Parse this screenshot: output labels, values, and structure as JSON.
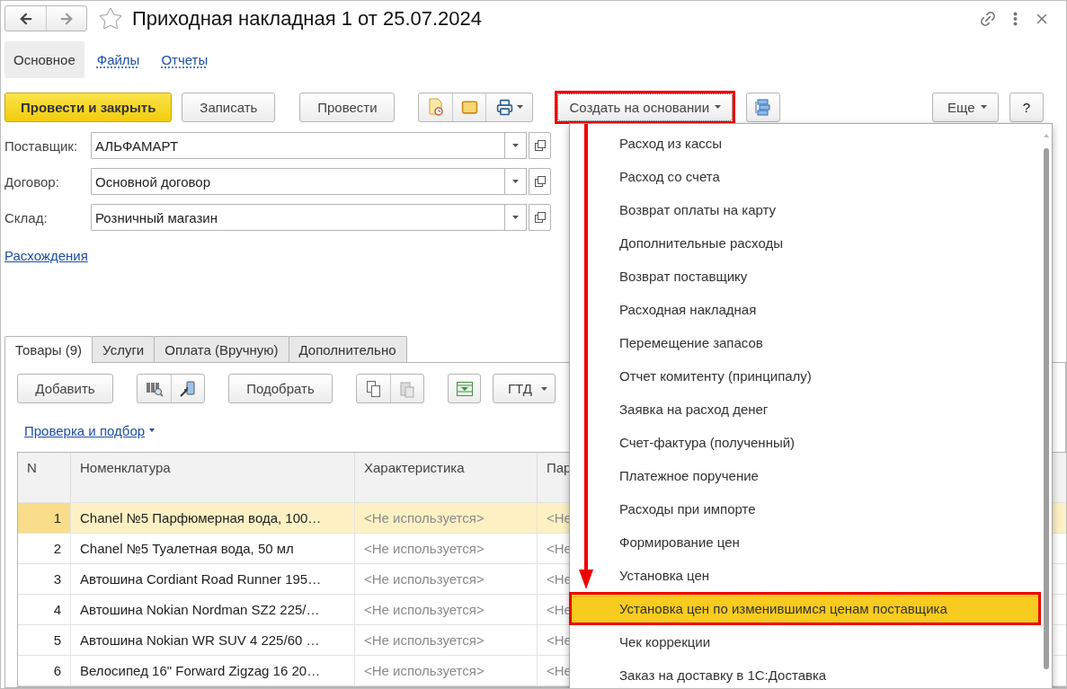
{
  "window": {
    "title": "Приходная накладная 1 от 25.07.2024"
  },
  "nav_tabs": [
    {
      "label": "Основное",
      "selected": true
    },
    {
      "label": "Файлы",
      "selected": false
    },
    {
      "label": "Отчеты",
      "selected": false
    }
  ],
  "command_bar": {
    "post_and_close": "Провести и закрыть",
    "save": "Записать",
    "post": "Провести",
    "create_based_on": {
      "label": "Создать на основании",
      "annotated": true
    },
    "more": "Еще",
    "help": "?"
  },
  "fields": [
    {
      "label": "Поставщик:",
      "value": "АЛЬФАМАРТ"
    },
    {
      "label": "Договор:",
      "value": "Основной договор"
    },
    {
      "label": "Склад:",
      "value": "Розничный магазин"
    }
  ],
  "discrepancies_link": "Расхождения",
  "table_tabs": [
    {
      "label": "Товары (9)",
      "selected": true
    },
    {
      "label": "Услуги",
      "selected": false
    },
    {
      "label": "Оплата (Вручную)",
      "selected": false
    },
    {
      "label": "Дополнительно",
      "selected": false
    }
  ],
  "table_toolbar": {
    "add": "Добавить",
    "pick": "Подобрать",
    "gtd": "ГТД"
  },
  "check_link": "Проверка и подбор",
  "table": {
    "columns": [
      "N",
      "Номенклатура",
      "Характеристика",
      "Пар"
    ],
    "rows": [
      {
        "n": "1",
        "name": "Chanel №5 Парфюмерная вода, 100…",
        "characteristic": "<Не используется>",
        "column_4": "<Не",
        "selected": true
      },
      {
        "n": "2",
        "name": "Chanel №5 Туалетная вода, 50 мл",
        "characteristic": "<Не используется>",
        "column_4": "<Не",
        "selected": false
      },
      {
        "n": "3",
        "name": "Автошина Cordiant Road Runner 195…",
        "characteristic": "<Не используется>",
        "column_4": "<Не",
        "selected": false
      },
      {
        "n": "4",
        "name": "Автошина Nokian Nordman SZ2 225/…",
        "characteristic": "<Не используется>",
        "column_4": "<Не",
        "selected": false
      },
      {
        "n": "5",
        "name": "Автошина Nokian WR SUV 4 225/60 …",
        "characteristic": "<Не используется>",
        "column_4": "<Не",
        "selected": false
      },
      {
        "n": "6",
        "name": "Велосипед 16\" Forward Zigzag 16 20…",
        "characteristic": "<Не используется>",
        "column_4": "<Не",
        "selected": false
      }
    ]
  },
  "menu": {
    "items": [
      {
        "label": "Расход из кассы",
        "selected": false,
        "annotated": false
      },
      {
        "label": "Расход со счета",
        "selected": false,
        "annotated": false
      },
      {
        "label": "Возврат оплаты на карту",
        "selected": false,
        "annotated": false
      },
      {
        "label": "Дополнительные расходы",
        "selected": false,
        "annotated": false
      },
      {
        "label": "Возврат поставщику",
        "selected": false,
        "annotated": false
      },
      {
        "label": "Расходная накладная",
        "selected": false,
        "annotated": false
      },
      {
        "label": "Перемещение запасов",
        "selected": false,
        "annotated": false
      },
      {
        "label": "Отчет комитенту (принципалу)",
        "selected": false,
        "annotated": false
      },
      {
        "label": "Заявка на расход денег",
        "selected": false,
        "annotated": false
      },
      {
        "label": "Счет-фактура (полученный)",
        "selected": false,
        "annotated": false
      },
      {
        "label": "Платежное поручение",
        "selected": false,
        "annotated": false
      },
      {
        "label": "Расходы при импорте",
        "selected": false,
        "annotated": false
      },
      {
        "label": "Формирование цен",
        "selected": false,
        "annotated": false
      },
      {
        "label": "Установка цен",
        "selected": false,
        "annotated": false
      },
      {
        "label": "Установка цен по изменившимся ценам поставщика",
        "selected": true,
        "annotated": true
      },
      {
        "label": "Чек коррекции",
        "selected": false,
        "annotated": false
      },
      {
        "label": "Заказ на доставку в 1С:Доставка",
        "selected": false,
        "annotated": false
      }
    ]
  }
}
